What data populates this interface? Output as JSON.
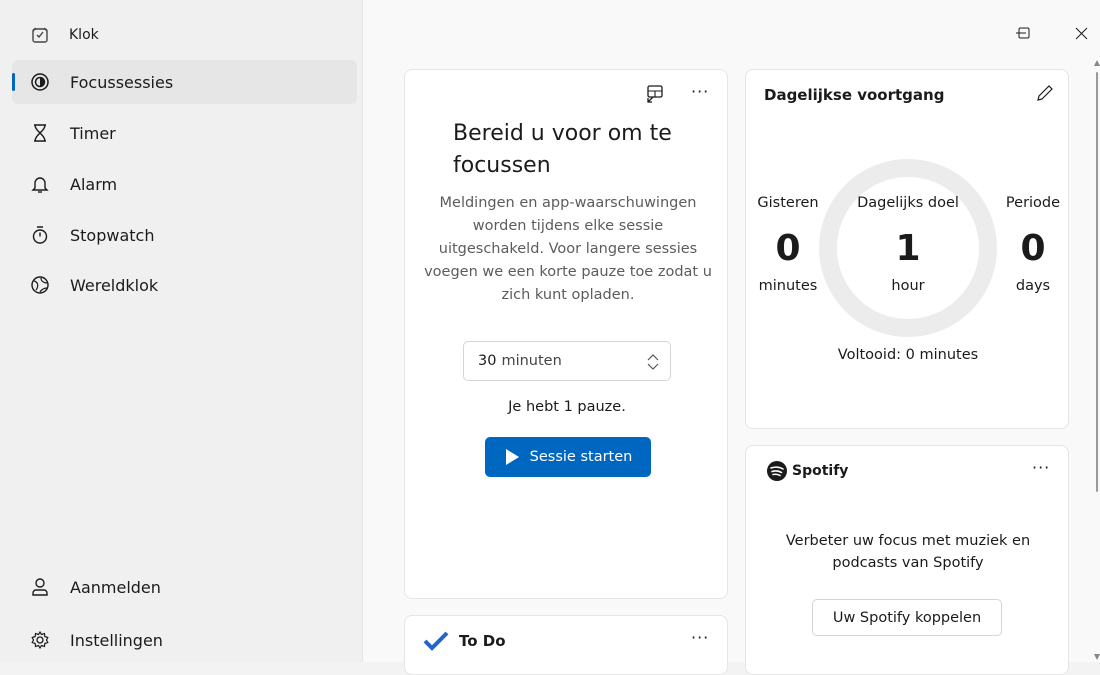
{
  "app": {
    "title": "Klok"
  },
  "nav": {
    "items": [
      {
        "label": "Focussessies",
        "icon": "focus-icon"
      },
      {
        "label": "Timer",
        "icon": "hourglass-icon"
      },
      {
        "label": "Alarm",
        "icon": "bell-icon"
      },
      {
        "label": "Stopwatch",
        "icon": "stopwatch-icon"
      },
      {
        "label": "Wereldklok",
        "icon": "globe-icon"
      }
    ],
    "bottom": [
      {
        "label": "Aanmelden",
        "icon": "person-icon"
      },
      {
        "label": "Instellingen",
        "icon": "gear-icon"
      }
    ],
    "selected_label": "Focussessies"
  },
  "focus_card": {
    "title": "Bereid u voor om te focussen",
    "description": "Meldingen en app-waarschuwingen worden tijdens elke sessie uitgeschakeld. Voor langere sessies voegen we een korte pauze toe zodat u zich kunt opladen.",
    "duration_value": "30",
    "duration_unit": "minuten",
    "breaks_text": "Je hebt 1 pauze.",
    "start_label": "Sessie starten"
  },
  "progress_card": {
    "title": "Dagelijkse voortgang",
    "yesterday": {
      "label": "Gisteren",
      "value": "0",
      "unit": "minutes"
    },
    "goal": {
      "label": "Dagelijks doel",
      "value": "1",
      "unit": "hour",
      "progress_fraction": 0
    },
    "streak": {
      "label": "Periode",
      "value": "0",
      "unit": "days"
    },
    "completed_text": "Voltooid: 0 minutes"
  },
  "spotify_card": {
    "brand": "Spotify",
    "text": "Verbeter uw focus met muziek en podcasts van Spotify",
    "button_label": "Uw Spotify koppelen"
  },
  "todo_card": {
    "title": "To Do"
  },
  "colors": {
    "accent": "#0067c0",
    "spotify": "#1b1b1b",
    "todo": "#2564cf"
  }
}
